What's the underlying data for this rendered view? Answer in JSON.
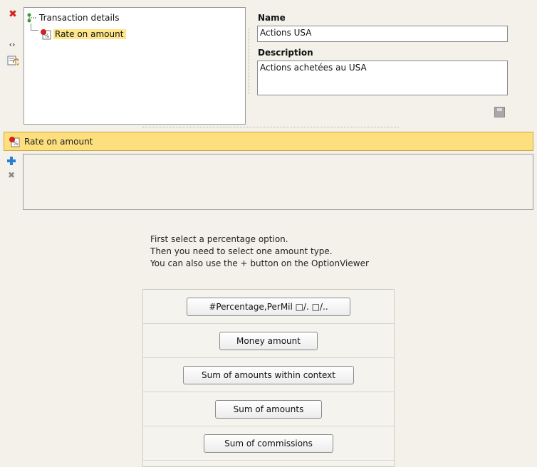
{
  "tree": {
    "root_label": "Transaction details",
    "child_label": "Rate on amount"
  },
  "form": {
    "name_label": "Name",
    "name_value": "Actions USA",
    "description_label": "Description",
    "description_value": "Actions achetées au USA"
  },
  "section": {
    "title": "Rate on amount"
  },
  "hint": {
    "line1": "First select a percentage option.",
    "line2": "Then you need to select one amount type.",
    "line3": "You can also use the + button on the OptionViewer"
  },
  "buttons": [
    {
      "label": "#Percentage,PerMil □/. □/.."
    },
    {
      "label": "Money amount"
    },
    {
      "label": "Sum of amounts within context"
    },
    {
      "label": "Sum of amounts"
    },
    {
      "label": "Sum of commissions"
    }
  ],
  "colors": {
    "accent": "#fddf7e",
    "selection": "#ffe68a",
    "delete_red": "#d42020",
    "add_blue": "#2a7fd4"
  },
  "icons": [
    "delete-icon",
    "expand-collapse-icon",
    "refresh-icon",
    "tree-root-icon",
    "rate-icon",
    "save-icon",
    "add-icon",
    "remove-icon"
  ]
}
